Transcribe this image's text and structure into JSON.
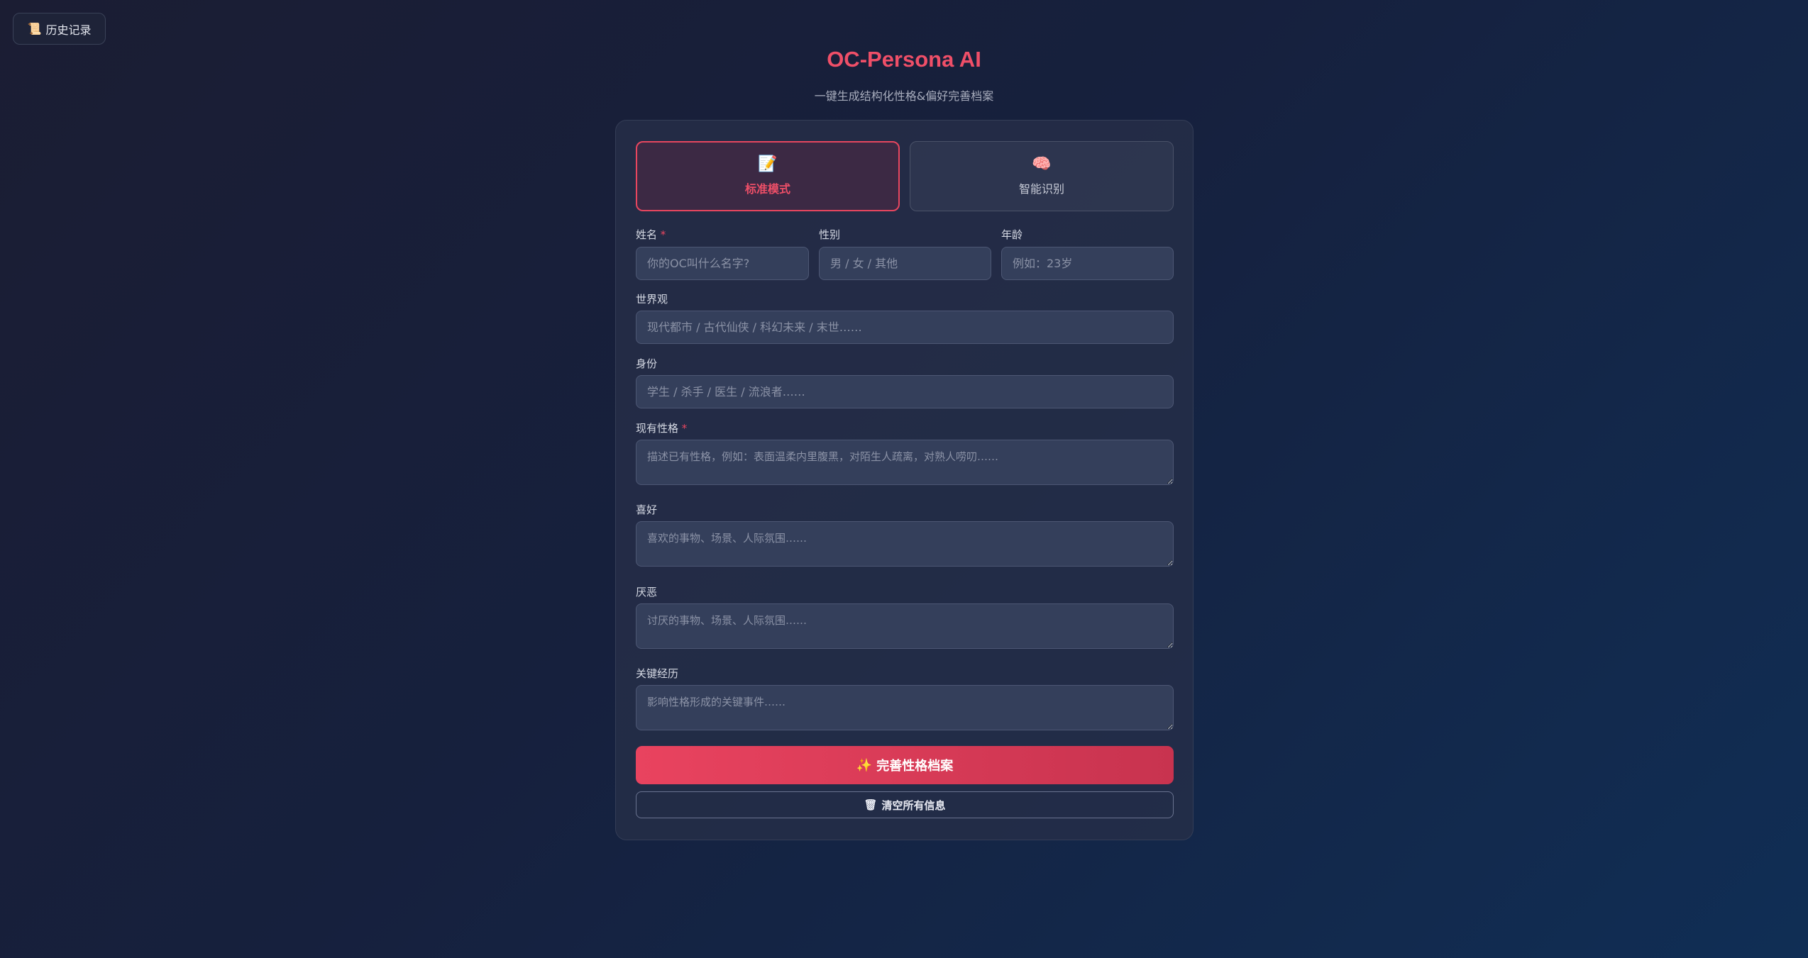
{
  "header": {
    "history_icon": "scroll-icon",
    "history_label": "历史记录",
    "title": "OC-Persona AI",
    "subtitle": "一键生成结构化性格&偏好完善档案"
  },
  "modes": {
    "standard": {
      "icon": "📝",
      "label": "标准模式"
    },
    "smart": {
      "icon": "🧠",
      "label": "智能识别"
    }
  },
  "form": {
    "name": {
      "label": "姓名",
      "required_mark": "*",
      "placeholder": "你的OC叫什么名字?"
    },
    "gender": {
      "label": "性别",
      "placeholder": "男 / 女 / 其他"
    },
    "age": {
      "label": "年龄",
      "placeholder": "例如：23岁"
    },
    "world": {
      "label": "世界观",
      "placeholder": "现代都市 / 古代仙侠 / 科幻未来 / 末世……"
    },
    "identity": {
      "label": "身份",
      "placeholder": "学生 / 杀手 / 医生 / 流浪者……"
    },
    "personality": {
      "label": "现有性格",
      "required_mark": "*",
      "placeholder": "描述已有性格，例如：表面温柔内里腹黑，对陌生人疏离，对熟人唠叨……"
    },
    "likes": {
      "label": "喜好",
      "placeholder": "喜欢的事物、场景、人际氛围……"
    },
    "dislikes": {
      "label": "厌恶",
      "placeholder": "讨厌的事物、场景、人际氛围……"
    },
    "experience": {
      "label": "关键经历",
      "placeholder": "影响性格形成的关键事件……"
    }
  },
  "actions": {
    "submit_icon": "✨",
    "submit_label": "完善性格档案",
    "clear_icon": "🗑",
    "clear_label": "清空所有信息"
  },
  "colors": {
    "accent": "#e8465f",
    "background_start": "#1b1d33",
    "background_end": "#102e55"
  }
}
